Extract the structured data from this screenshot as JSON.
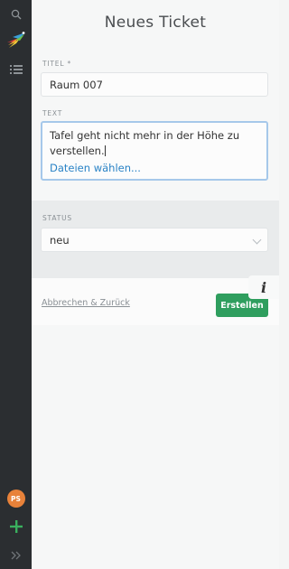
{
  "sidebar": {
    "icons": [
      "search-icon",
      "app-logo",
      "list-icon",
      "plus-icon",
      "expand-icon"
    ],
    "avatar_initials": "PS",
    "avatar_color": "#e8823a",
    "plus_color": "#3ab05e"
  },
  "form": {
    "page_title": "Neues Ticket",
    "title_label": "TITEL *",
    "title_value": "Raum 007",
    "text_label": "TEXT",
    "text_value": "Tafel geht nicht mehr in der Höhe zu verstellen.",
    "files_link": "Dateien wählen...",
    "status_label": "STATUS",
    "status_value": "neu"
  },
  "actions": {
    "info_symbol": "i",
    "cancel_label": "Abbrechen & Zurück",
    "create_label": "Erstellen",
    "create_color": "#2f9e5e"
  }
}
